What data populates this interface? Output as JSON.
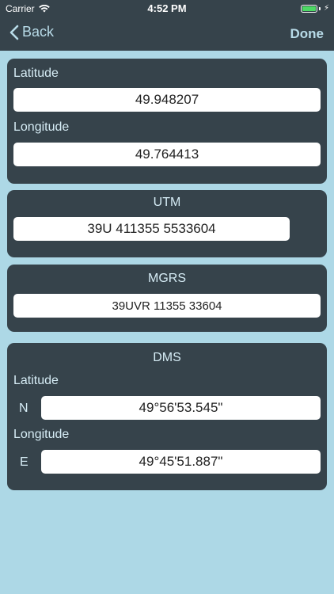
{
  "status_bar": {
    "carrier": "Carrier",
    "time": "4:52 PM",
    "wifi_icon": "wifi-icon",
    "battery_icon": "battery-icon",
    "battery_level": 1.0
  },
  "nav": {
    "back_label": "Back",
    "done_label": "Done"
  },
  "latlon": {
    "latitude_label": "Latitude",
    "latitude_value": "49.948207",
    "longitude_label": "Longitude",
    "longitude_value": "49.764413"
  },
  "utm": {
    "title": "UTM",
    "value": "39U 411355 5533604"
  },
  "mgrs": {
    "title": "MGRS",
    "value": "39UVR 11355 33604"
  },
  "dms": {
    "title": "DMS",
    "latitude_label": "Latitude",
    "latitude_dir": "N",
    "latitude_value": "49°56'53.545\"",
    "longitude_label": "Longitude",
    "longitude_dir": "E",
    "longitude_value": "49°45'51.887\""
  },
  "colors": {
    "background": "#add8e6",
    "panel": "#36434b",
    "accent": "#b8dbe8",
    "battery": "#4cd964"
  }
}
